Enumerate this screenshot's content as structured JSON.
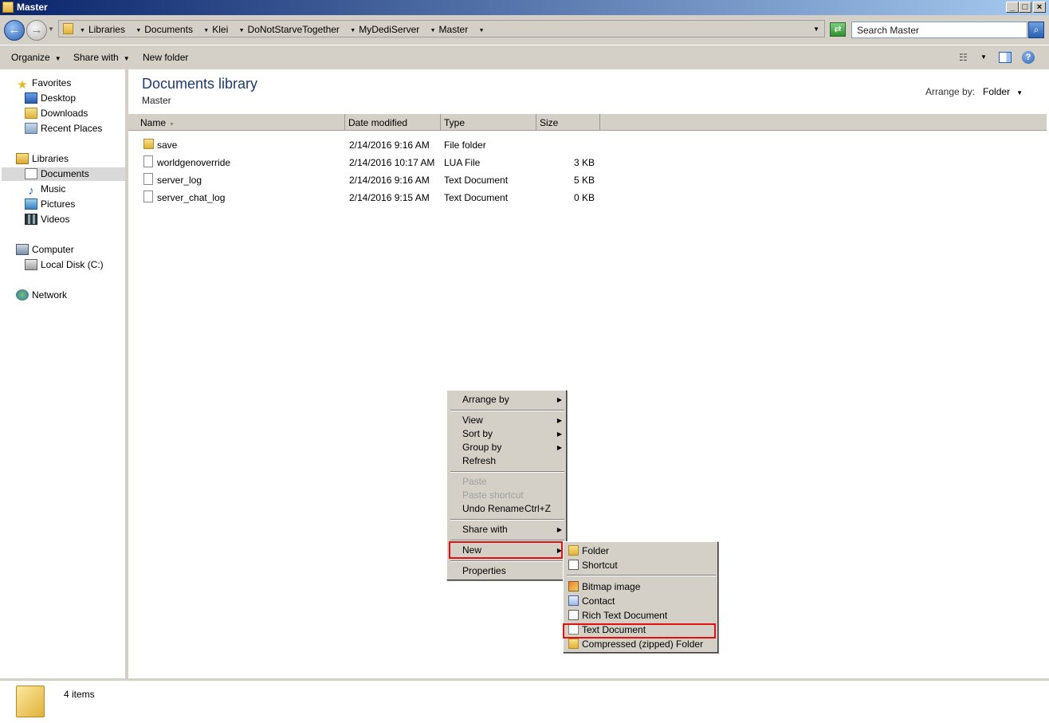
{
  "window": {
    "title": "Master"
  },
  "address": {
    "crumbs": [
      "Libraries",
      "Documents",
      "Klei",
      "DoNotStarveTogether",
      "MyDediServer",
      "Master"
    ],
    "search_placeholder": "Search Master"
  },
  "toolbar": {
    "organize": "Organize",
    "share_with": "Share with",
    "new_folder": "New folder"
  },
  "nav": {
    "favorites": "Favorites",
    "desktop": "Desktop",
    "downloads": "Downloads",
    "recent": "Recent Places",
    "libraries": "Libraries",
    "documents": "Documents",
    "music": "Music",
    "pictures": "Pictures",
    "videos": "Videos",
    "computer": "Computer",
    "local_disk": "Local Disk (C:)",
    "network": "Network"
  },
  "main": {
    "title": "Documents library",
    "subtitle": "Master",
    "arrange_label": "Arrange by:",
    "arrange_value": "Folder",
    "columns": {
      "name": "Name",
      "date": "Date modified",
      "type": "Type",
      "size": "Size"
    },
    "files": [
      {
        "name": "save",
        "date": "2/14/2016 9:16 AM",
        "type": "File folder",
        "size": ""
      },
      {
        "name": "worldgenoverride",
        "date": "2/14/2016 10:17 AM",
        "type": "LUA File",
        "size": "3 KB"
      },
      {
        "name": "server_log",
        "date": "2/14/2016 9:16 AM",
        "type": "Text Document",
        "size": "5 KB"
      },
      {
        "name": "server_chat_log",
        "date": "2/14/2016 9:15 AM",
        "type": "Text Document",
        "size": "0 KB"
      }
    ]
  },
  "status": {
    "count": "4 items"
  },
  "context_menu": {
    "arrange_by": "Arrange by",
    "view": "View",
    "sort_by": "Sort by",
    "group_by": "Group by",
    "refresh": "Refresh",
    "paste": "Paste",
    "paste_shortcut": "Paste shortcut",
    "undo_rename": "Undo Rename",
    "undo_shortcut": "Ctrl+Z",
    "share_with": "Share with",
    "new": "New",
    "properties": "Properties"
  },
  "new_submenu": {
    "folder": "Folder",
    "shortcut": "Shortcut",
    "bitmap": "Bitmap image",
    "contact": "Contact",
    "rtf": "Rich Text Document",
    "text": "Text Document",
    "zip": "Compressed (zipped) Folder"
  },
  "colors": {
    "highlight_border": "#e01010",
    "title_gradient_start": "#0a246a",
    "title_gradient_end": "#a6caf0"
  }
}
